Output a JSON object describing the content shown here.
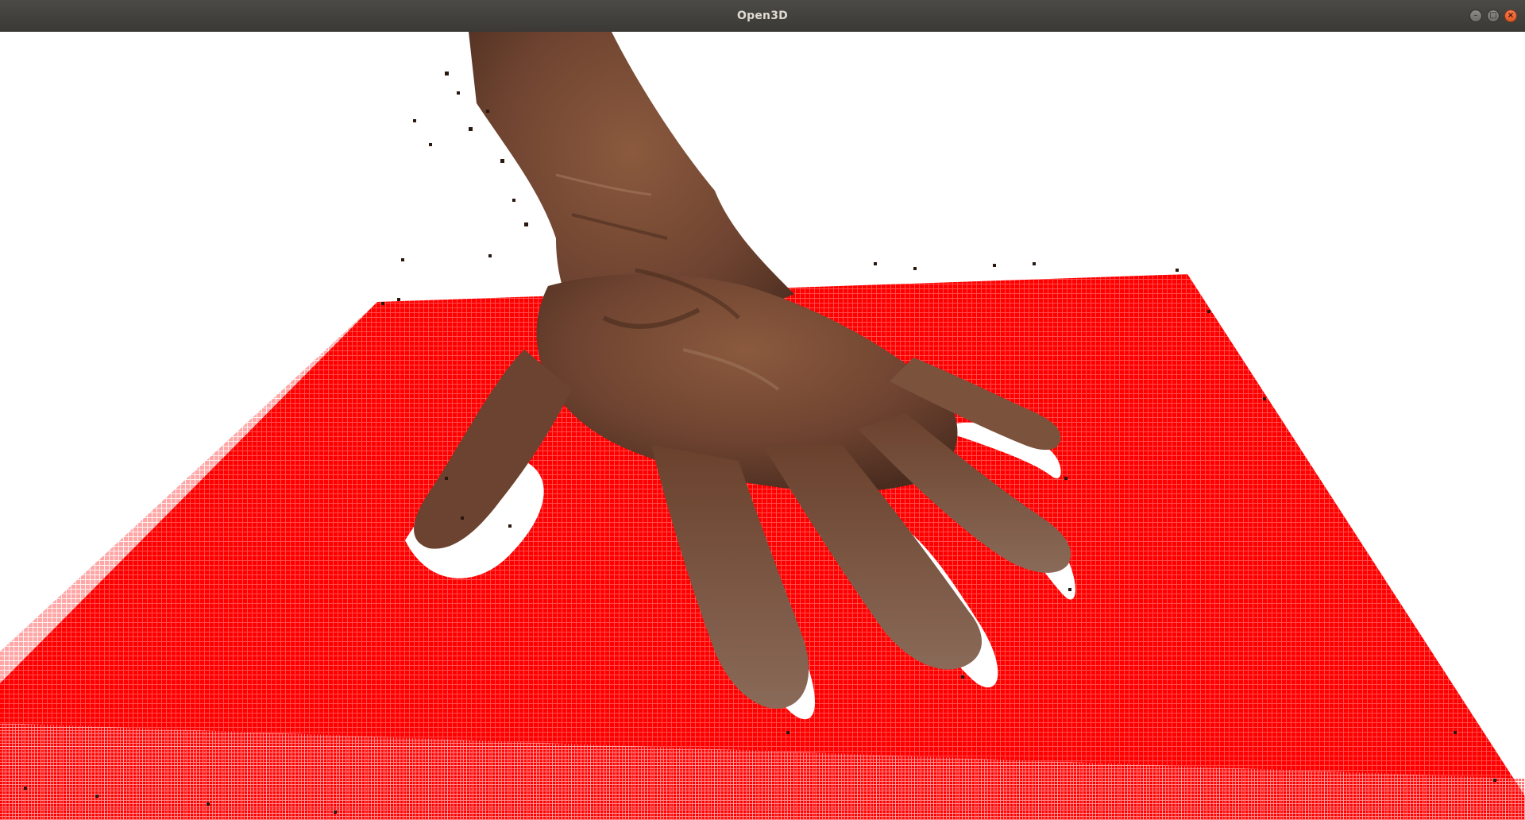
{
  "window": {
    "title": "Open3D"
  },
  "controls": {
    "minimize_icon": "minimize-icon",
    "maximize_icon": "maximize-icon",
    "close_icon": "close-icon"
  },
  "scene": {
    "background_color": "#ffffff",
    "plane_color": "#ff0000",
    "skin_color": "#7a4a32",
    "skin_dark_color": "#4a2a1c"
  }
}
